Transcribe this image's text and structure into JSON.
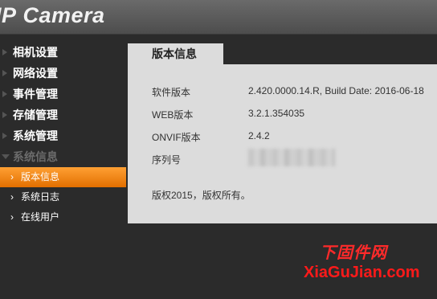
{
  "header": {
    "logo_ip": "IP",
    "logo_camera": "Camera"
  },
  "sidebar": {
    "menu": [
      {
        "label": "相机设置"
      },
      {
        "label": "网络设置"
      },
      {
        "label": "事件管理"
      },
      {
        "label": "存储管理"
      },
      {
        "label": "系统管理"
      },
      {
        "label": "系统信息"
      }
    ],
    "submenu": [
      {
        "label": "版本信息"
      },
      {
        "label": "系统日志"
      },
      {
        "label": "在线用户"
      }
    ]
  },
  "tab": {
    "label": "版本信息"
  },
  "info": {
    "software_label": "软件版本",
    "software_value": "2.420.0000.14.R, Build Date: 2016-06-18",
    "web_label": "WEB版本",
    "web_value": "3.2.1.354035",
    "onvif_label": "ONVIF版本",
    "onvif_value": "2.4.2",
    "serial_label": "序列号",
    "copyright": "版权2015，版权所有。"
  },
  "watermark": {
    "top": "下固件网",
    "bottom": "XiaGuJian.com"
  },
  "colors": {
    "accent": "#f08a1c",
    "panel": "#dcdcdc",
    "background": "#2b2b2b"
  }
}
